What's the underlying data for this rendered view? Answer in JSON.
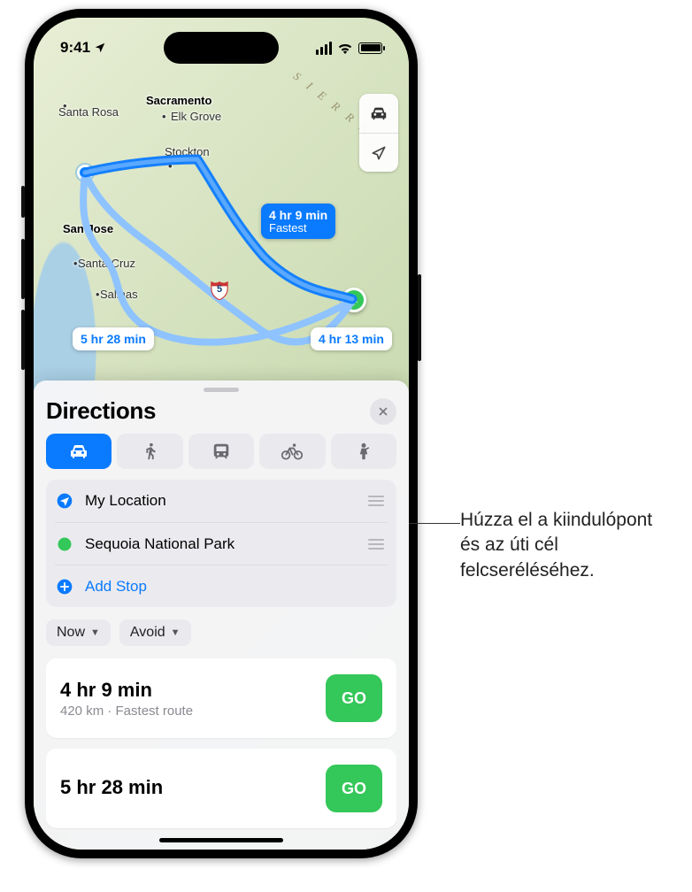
{
  "statusbar": {
    "time": "9:41"
  },
  "map": {
    "labels": {
      "santa_rosa": "Santa Rosa",
      "sacramento": "Sacramento",
      "elk_grove": "Elk Grove",
      "stockton": "Stockton",
      "san_jose": "San Jose",
      "santa_cruz": "Santa Cruz",
      "salinas": "Salinas",
      "sierra": "SIERRA"
    },
    "highways": {
      "i5": "5"
    },
    "controls": {
      "mode": "driving",
      "locate": "locate"
    },
    "badges": {
      "fastest_time": "4 hr 9 min",
      "fastest_sub": "Fastest",
      "alt2_time": "4 hr 13 min",
      "alt3_time": "5 hr 28 min"
    }
  },
  "sheet": {
    "title": "Directions",
    "stops": {
      "from": "My Location",
      "to": "Sequoia National Park",
      "add": "Add Stop"
    },
    "options": {
      "now": "Now",
      "avoid": "Avoid"
    },
    "routes": [
      {
        "duration": "4 hr 9 min",
        "detail": "420 km · Fastest route",
        "go": "GO"
      },
      {
        "duration": "5 hr 28 min",
        "detail": "",
        "go": "GO"
      }
    ]
  },
  "callout": {
    "text": "Húzza el a kiindulópont és az úti cél felcseréléséhez."
  }
}
